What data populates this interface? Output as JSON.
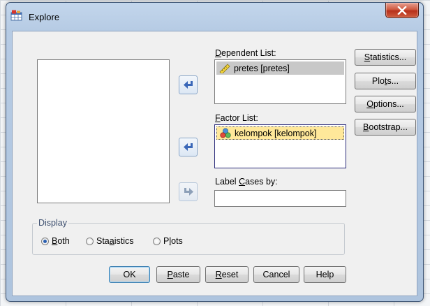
{
  "window": {
    "title": "Explore",
    "title_icon": "spss-explore-icon"
  },
  "lists": {
    "dependent_label": "Dependent List:",
    "dependent_items": [
      {
        "label": "pretes [pretes]",
        "icon": "ruler-scale-icon"
      }
    ],
    "factor_label": "Factor List:",
    "factor_items": [
      {
        "label": "kelompok [kelompok]",
        "icon": "nominal-variable-icon"
      }
    ],
    "label_cases_label": "Label Cases by:"
  },
  "side_buttons": [
    "Statistics...",
    "Plots...",
    "Options...",
    "Bootstrap..."
  ],
  "display": {
    "title": "Display",
    "options": [
      "Both",
      "Statistics",
      "Plots"
    ],
    "selected": "Both"
  },
  "footer_buttons": [
    "OK",
    "Paste",
    "Reset",
    "Cancel",
    "Help"
  ],
  "colors": {
    "title_bar": "#b6cbe4",
    "close_button": "#c8452b",
    "selected_item": "#ffe89a"
  }
}
